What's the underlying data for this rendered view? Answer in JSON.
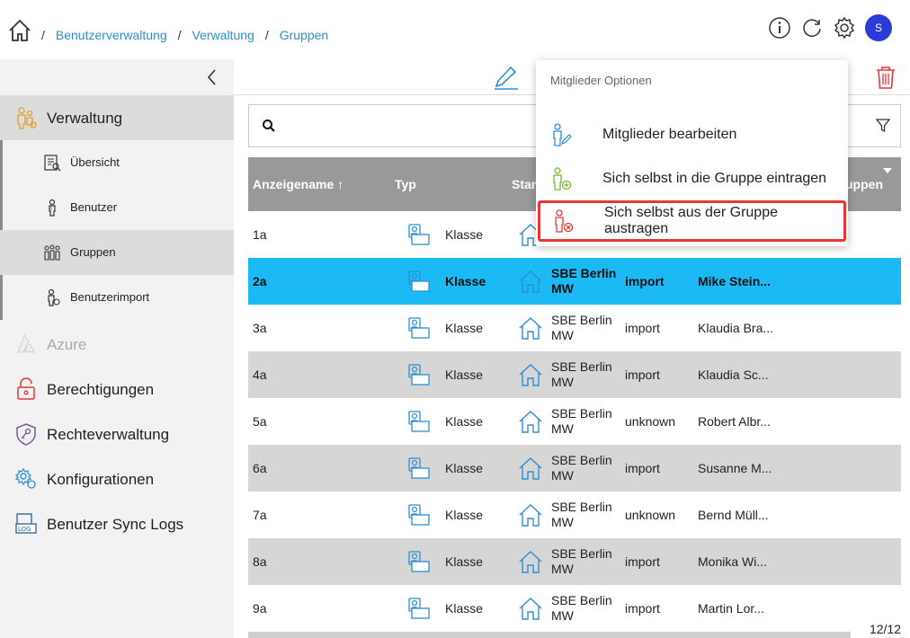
{
  "breadcrumb": {
    "items": [
      "Benutzerverwaltung",
      "Verwaltung",
      "Gruppen"
    ],
    "separator": "/"
  },
  "header": {
    "avatar_initial": "S"
  },
  "sidebar": {
    "items": [
      {
        "label": "Verwaltung"
      },
      {
        "label": "Übersicht"
      },
      {
        "label": "Benutzer"
      },
      {
        "label": "Gruppen"
      },
      {
        "label": "Benutzerimport"
      },
      {
        "label": "Azure"
      },
      {
        "label": "Berechtigungen"
      },
      {
        "label": "Rechteverwaltung"
      },
      {
        "label": "Konfigurationen"
      },
      {
        "label": "Benutzer Sync Logs"
      }
    ]
  },
  "table": {
    "columns": [
      "Anzeigename",
      "Typ",
      "Stan",
      "uppen"
    ],
    "rows": [
      {
        "name": "1a",
        "typ": "Klasse",
        "standort": "",
        "quelle": "",
        "owner": ""
      },
      {
        "name": "2a",
        "typ": "Klasse",
        "standort": "SBE Berlin MW",
        "quelle": "import",
        "owner": "Mike Stein..."
      },
      {
        "name": "3a",
        "typ": "Klasse",
        "standort": "SBE Berlin MW",
        "quelle": "import",
        "owner": "Klaudia Bra..."
      },
      {
        "name": "4a",
        "typ": "Klasse",
        "standort": "SBE Berlin MW",
        "quelle": "import",
        "owner": "Klaudia Sc..."
      },
      {
        "name": "5a",
        "typ": "Klasse",
        "standort": "SBE Berlin MW",
        "quelle": "unknown",
        "owner": "Robert Albr..."
      },
      {
        "name": "6a",
        "typ": "Klasse",
        "standort": "SBE Berlin MW",
        "quelle": "import",
        "owner": "Susanne M..."
      },
      {
        "name": "7a",
        "typ": "Klasse",
        "standort": "SBE Berlin MW",
        "quelle": "unknown",
        "owner": "Bernd Müll..."
      },
      {
        "name": "8a",
        "typ": "Klasse",
        "standort": "SBE Berlin MW",
        "quelle": "import",
        "owner": "Monika Wi..."
      },
      {
        "name": "9a",
        "typ": "Klasse",
        "standort": "SBE Berlin MW",
        "quelle": "import",
        "owner": "Martin Lor..."
      }
    ],
    "count": "12/12"
  },
  "menu": {
    "title": "Mitglieder Optionen",
    "items": [
      {
        "label": "Mitglieder bearbeiten"
      },
      {
        "label": "Sich selbst in die Gruppe eintragen"
      },
      {
        "label": "Sich selbst aus der Gruppe austragen"
      }
    ]
  },
  "colors": {
    "link": "#2e8fd0",
    "selected_row": "#1bbaf5",
    "header_row": "#999999",
    "avatar": "#2b3bd6",
    "danger": "#e53935"
  }
}
